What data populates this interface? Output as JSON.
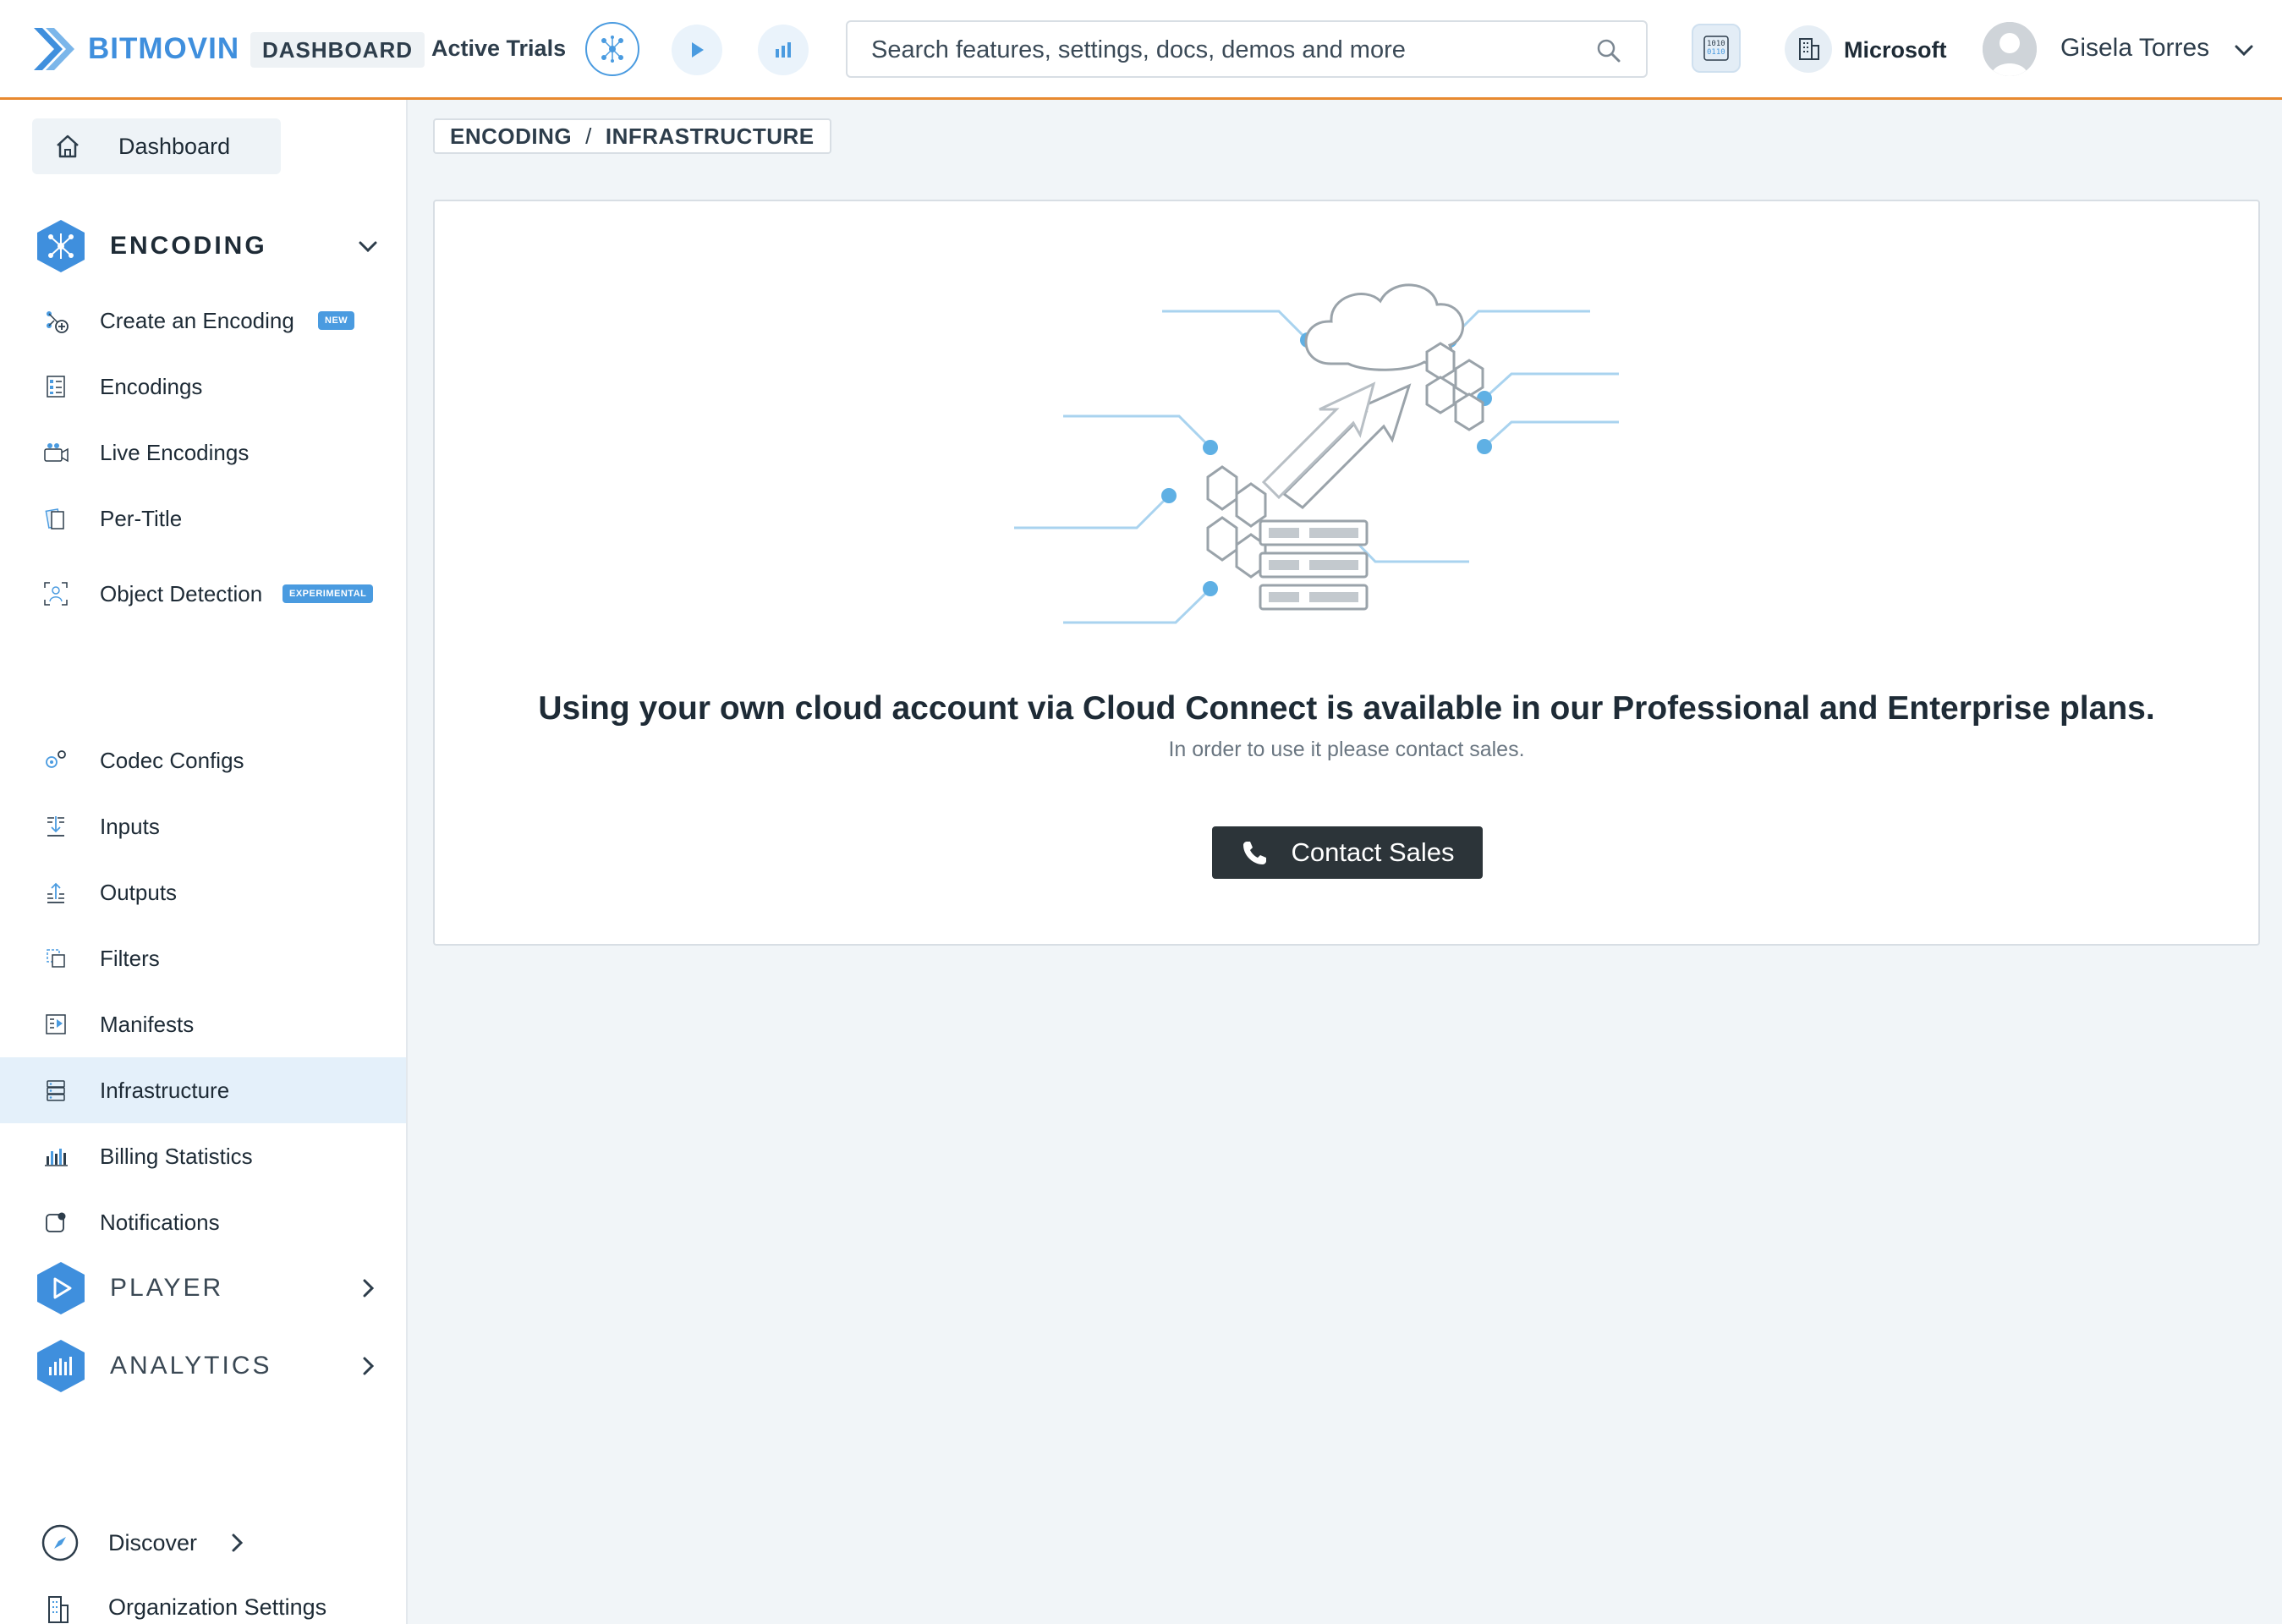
{
  "header": {
    "brand": "BITMOVIN",
    "dashboard_badge": "DASHBOARD",
    "trials_label": "Active Trials",
    "search_placeholder": "Search features, settings, docs, demos and more",
    "organization": "Microsoft",
    "user_name": "Gisela Torres"
  },
  "sidebar": {
    "dashboard": "Dashboard",
    "encoding_title": "ENCODING",
    "encoding_items": [
      {
        "label": "Create an Encoding",
        "badge": "NEW"
      },
      {
        "label": "Encodings"
      },
      {
        "label": "Live Encodings"
      },
      {
        "label": "Per-Title"
      },
      {
        "label": "Object Detection",
        "badge": "EXPERIMENTAL"
      },
      {
        "label": "Codec Configs"
      },
      {
        "label": "Inputs"
      },
      {
        "label": "Outputs"
      },
      {
        "label": "Filters"
      },
      {
        "label": "Manifests"
      },
      {
        "label": "Infrastructure",
        "active": true
      },
      {
        "label": "Billing Statistics"
      },
      {
        "label": "Notifications"
      }
    ],
    "player_title": "PLAYER",
    "analytics_title": "ANALYTICS",
    "discover": "Discover",
    "org_settings": "Organization Settings"
  },
  "breadcrumb": {
    "part1": "ENCODING",
    "separator": "/",
    "part2": "INFRASTRUCTURE"
  },
  "main": {
    "headline": "Using your own cloud account via Cloud Connect is available in our Professional and Enterprise plans.",
    "subline": "In order to use it please contact sales.",
    "contact_button": "Contact Sales"
  },
  "colors": {
    "accent_blue": "#4a9be0",
    "topbar_border": "#e8892f",
    "active_nav_bg": "#e4f0fa",
    "button_dark": "#2c3439"
  },
  "icons": {
    "logo": "bitmovin-logo-icon",
    "search": "search-icon",
    "phone": "phone-icon",
    "home": "home-icon"
  }
}
